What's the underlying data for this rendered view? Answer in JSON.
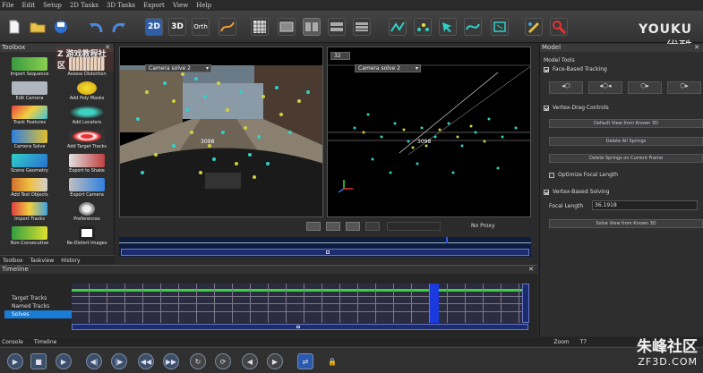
{
  "menu": [
    "File",
    "Edit",
    "Setup",
    "2D Tasks",
    "3D Tasks",
    "Export",
    "View",
    "Help"
  ],
  "toolbar": {
    "btn_2d": "2D",
    "btn_3d": "3D",
    "btn_orth": "Orth"
  },
  "watermark": {
    "brand": "YOUKU",
    "sub": "优酷"
  },
  "toolbox": {
    "title": "Toolbox",
    "overlay": "Z 游戏教程社区",
    "items": [
      "Import Sequence",
      "Assess Distortion",
      "Edit Camera",
      "Add Poly Masks",
      "Track Features",
      "Add Locators",
      "Camera Solve",
      "Add Target Tracks",
      "Scene Geometry",
      "Export to Shake",
      "Add Test Objects",
      "Export Camera",
      "Import Tracks",
      "Preferences",
      "Non-Consecutive",
      "Re-Distort Images"
    ],
    "tabs": [
      "Toolbox",
      "Taskview",
      "History"
    ]
  },
  "viewports": {
    "left_camera": "Camera solve 2",
    "left_label": "3098",
    "right_field": "32",
    "right_camera": "Camera solve 2",
    "right_label": "3098",
    "proxy": "No Proxy"
  },
  "model": {
    "title": "Model",
    "tools_label": "Model Tools",
    "face_based": "Face-Based Tracking",
    "vertex_drag": "Vertex-Drag Controls",
    "btn_default": "Default View from Known 3D",
    "btn_delete_all": "Delete All Springs",
    "btn_delete_current": "Delete Springs on Current Frame",
    "optimize": "Optimize Focal Length",
    "vertex_solving": "Vertex-Based Solving",
    "focal_label": "Focal Length",
    "focal_value": "36.1918",
    "btn_solve": "Solve View from Known 3D"
  },
  "timeline": {
    "title": "Timeline",
    "tracks": [
      "Target Tracks",
      "Named Tracks",
      "Solves"
    ]
  },
  "bottom_tabs": [
    "Console",
    "Timeline"
  ],
  "zoom_tab": "Zoom",
  "zoom_val": "T7",
  "zf_logo": {
    "cn": "朱峰社区",
    "url": "ZF3D.COM"
  }
}
